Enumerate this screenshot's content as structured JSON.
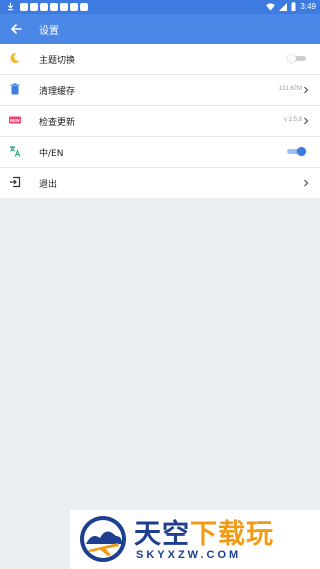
{
  "statusbar": {
    "time": "3:49"
  },
  "appbar": {
    "title": "设置"
  },
  "settings": [
    {
      "label": "主题切换",
      "icon": "moon-icon",
      "type": "toggle",
      "on": false
    },
    {
      "label": "清理缓存",
      "icon": "trash-icon",
      "type": "value",
      "value": "121.67M"
    },
    {
      "label": "检查更新",
      "icon": "new-badge-icon",
      "type": "value",
      "value": "v 2.5.8"
    },
    {
      "label": "中/EN",
      "icon": "translate-icon",
      "type": "toggle",
      "on": true
    },
    {
      "label": "退出",
      "icon": "exit-icon",
      "type": "chevron"
    }
  ],
  "watermark": {
    "cn_main": "天空",
    "cn_accent": "下载玩",
    "en": "SKYXZW.COM"
  },
  "colors": {
    "primary": "#4b87e6",
    "statusbar": "#3d7be0",
    "background": "#eceff1",
    "toggle_on": "#3d7be0"
  }
}
